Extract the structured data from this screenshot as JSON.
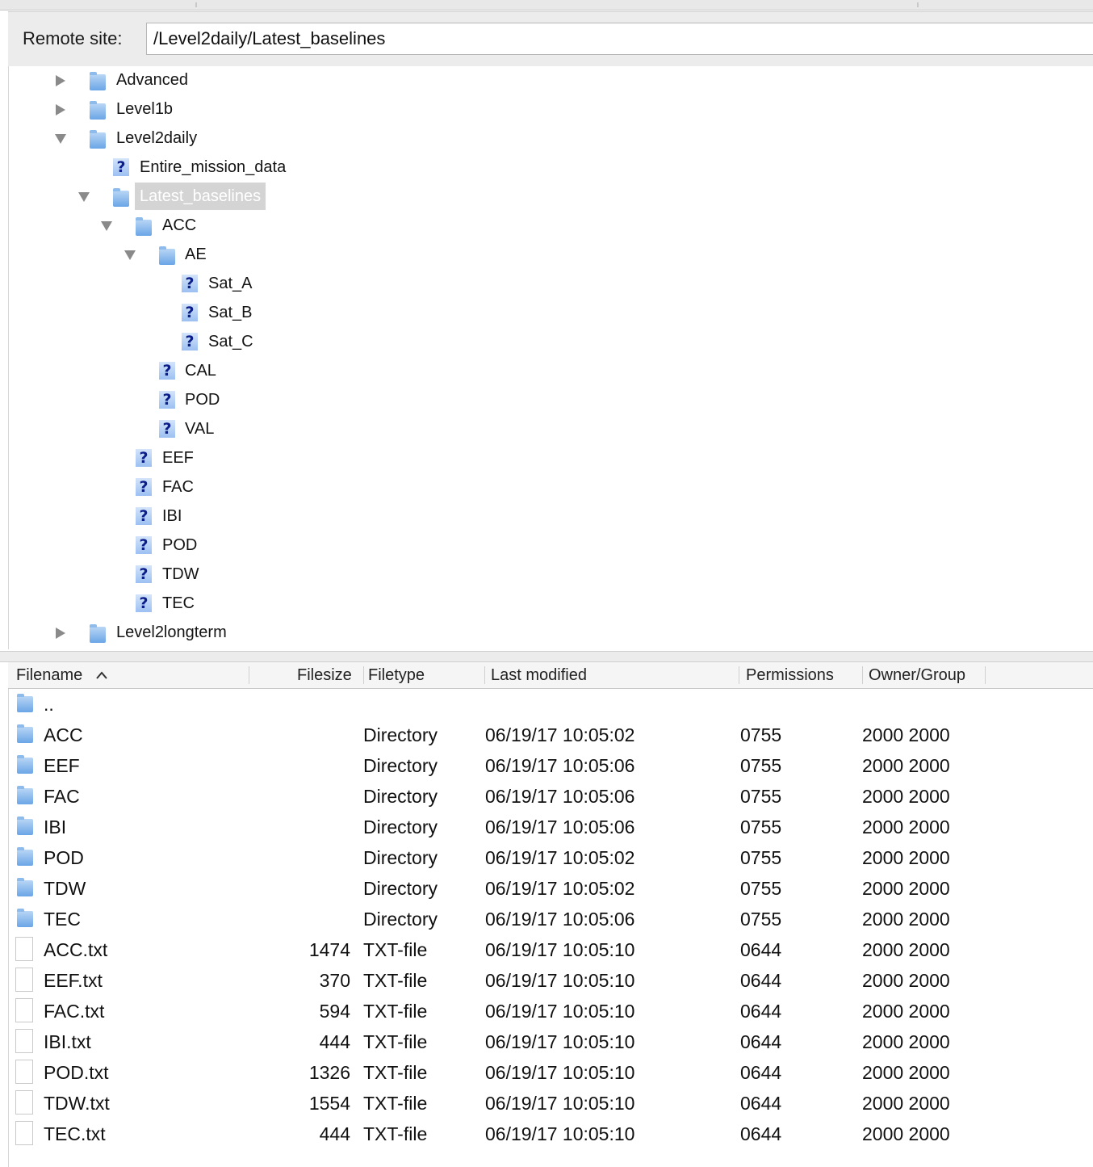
{
  "remote_site": {
    "label": "Remote site:",
    "path": "/Level2daily/Latest_baselines"
  },
  "tree": {
    "items": [
      {
        "label": "Advanced",
        "icon": "folder",
        "expander": "collapsed"
      },
      {
        "label": "Level1b",
        "icon": "folder",
        "expander": "collapsed"
      },
      {
        "label": "Level2daily",
        "icon": "folder",
        "expander": "expanded"
      },
      {
        "label": "Entire_mission_data",
        "icon": "unknown",
        "expander": "none"
      },
      {
        "label": "Latest_baselines",
        "icon": "folder",
        "expander": "expanded",
        "selected": true
      },
      {
        "label": "ACC",
        "icon": "folder",
        "expander": "expanded"
      },
      {
        "label": "AE",
        "icon": "folder",
        "expander": "expanded"
      },
      {
        "label": "Sat_A",
        "icon": "unknown",
        "expander": "none"
      },
      {
        "label": "Sat_B",
        "icon": "unknown",
        "expander": "none"
      },
      {
        "label": "Sat_C",
        "icon": "unknown",
        "expander": "none"
      },
      {
        "label": "CAL",
        "icon": "unknown",
        "expander": "none"
      },
      {
        "label": "POD",
        "icon": "unknown",
        "expander": "none"
      },
      {
        "label": "VAL",
        "icon": "unknown",
        "expander": "none"
      },
      {
        "label": "EEF",
        "icon": "unknown",
        "expander": "none"
      },
      {
        "label": "FAC",
        "icon": "unknown",
        "expander": "none"
      },
      {
        "label": "IBI",
        "icon": "unknown",
        "expander": "none"
      },
      {
        "label": "POD",
        "icon": "unknown",
        "expander": "none"
      },
      {
        "label": "TDW",
        "icon": "unknown",
        "expander": "none"
      },
      {
        "label": "TEC",
        "icon": "unknown",
        "expander": "none"
      },
      {
        "label": "Level2longterm",
        "icon": "folder",
        "expander": "collapsed"
      }
    ]
  },
  "file_list": {
    "columns": {
      "filename": "Filename",
      "filesize": "Filesize",
      "filetype": "Filetype",
      "last_modified": "Last modified",
      "permissions": "Permissions",
      "owner_group": "Owner/Group"
    },
    "sort_icon": "chevron-up-icon",
    "rows": [
      {
        "icon": "folder",
        "name": "..",
        "size": "",
        "type": "",
        "modified": "",
        "perms": "",
        "owner": ""
      },
      {
        "icon": "folder",
        "name": "ACC",
        "size": "",
        "type": "Directory",
        "modified": "06/19/17 10:05:02",
        "perms": "0755",
        "owner": "2000 2000"
      },
      {
        "icon": "folder",
        "name": "EEF",
        "size": "",
        "type": "Directory",
        "modified": "06/19/17 10:05:06",
        "perms": "0755",
        "owner": "2000 2000"
      },
      {
        "icon": "folder",
        "name": "FAC",
        "size": "",
        "type": "Directory",
        "modified": "06/19/17 10:05:06",
        "perms": "0755",
        "owner": "2000 2000"
      },
      {
        "icon": "folder",
        "name": "IBI",
        "size": "",
        "type": "Directory",
        "modified": "06/19/17 10:05:06",
        "perms": "0755",
        "owner": "2000 2000"
      },
      {
        "icon": "folder",
        "name": "POD",
        "size": "",
        "type": "Directory",
        "modified": "06/19/17 10:05:02",
        "perms": "0755",
        "owner": "2000 2000"
      },
      {
        "icon": "folder",
        "name": "TDW",
        "size": "",
        "type": "Directory",
        "modified": "06/19/17 10:05:02",
        "perms": "0755",
        "owner": "2000 2000"
      },
      {
        "icon": "folder",
        "name": "TEC",
        "size": "",
        "type": "Directory",
        "modified": "06/19/17 10:05:06",
        "perms": "0755",
        "owner": "2000 2000"
      },
      {
        "icon": "file",
        "name": "ACC.txt",
        "size": "1474",
        "type": "TXT-file",
        "modified": "06/19/17 10:05:10",
        "perms": "0644",
        "owner": "2000 2000"
      },
      {
        "icon": "file",
        "name": "EEF.txt",
        "size": "370",
        "type": "TXT-file",
        "modified": "06/19/17 10:05:10",
        "perms": "0644",
        "owner": "2000 2000"
      },
      {
        "icon": "file",
        "name": "FAC.txt",
        "size": "594",
        "type": "TXT-file",
        "modified": "06/19/17 10:05:10",
        "perms": "0644",
        "owner": "2000 2000"
      },
      {
        "icon": "file",
        "name": "IBI.txt",
        "size": "444",
        "type": "TXT-file",
        "modified": "06/19/17 10:05:10",
        "perms": "0644",
        "owner": "2000 2000"
      },
      {
        "icon": "file",
        "name": "POD.txt",
        "size": "1326",
        "type": "TXT-file",
        "modified": "06/19/17 10:05:10",
        "perms": "0644",
        "owner": "2000 2000"
      },
      {
        "icon": "file",
        "name": "TDW.txt",
        "size": "1554",
        "type": "TXT-file",
        "modified": "06/19/17 10:05:10",
        "perms": "0644",
        "owner": "2000 2000"
      },
      {
        "icon": "file",
        "name": "TEC.txt",
        "size": "444",
        "type": "TXT-file",
        "modified": "06/19/17 10:05:10",
        "perms": "0644",
        "owner": "2000 2000"
      }
    ]
  }
}
